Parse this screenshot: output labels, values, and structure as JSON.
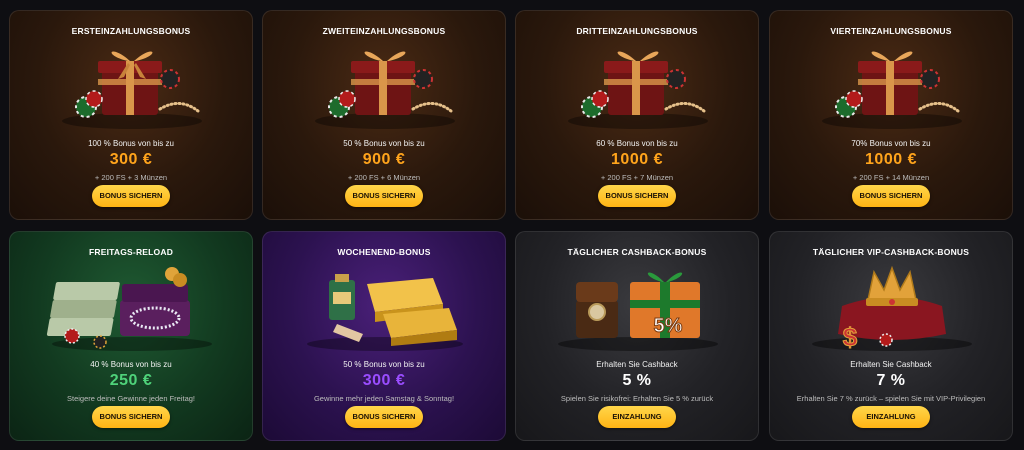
{
  "cards": [
    {
      "title": "ERSTEINZAHLUNGSBONUS",
      "desc": "100 % Bonus von bis zu",
      "amount": "300 €",
      "sub": "+ 200 FS + 3 Münzen",
      "button": "BONUS SICHERN",
      "art": "gift-box-icon"
    },
    {
      "title": "ZWEITEINZAHLUNGSBONUS",
      "desc": "50 % Bonus von bis zu",
      "amount": "900 €",
      "sub": "+ 200 FS + 6 Münzen",
      "button": "BONUS SICHERN",
      "art": "gift-box-icon"
    },
    {
      "title": "DRITTEINZAHLUNGSBONUS",
      "desc": "60 % Bonus von bis zu",
      "amount": "1000 €",
      "sub": "+ 200 FS + 7 Münzen",
      "button": "BONUS SICHERN",
      "art": "gift-box-icon"
    },
    {
      "title": "VIERTEINZAHLUNGSBONUS",
      "desc": "70% Bonus von bis zu",
      "amount": "1000 €",
      "sub": "+ 200 FS + 14 Münzen",
      "button": "BONUS SICHERN",
      "art": "gift-box-icon"
    },
    {
      "title": "FREITAGS-RELOAD",
      "desc": "40 % Bonus von bis zu",
      "amount": "250 €",
      "sub": "Steigere deine Gewinne jeden Freitag!",
      "button": "BONUS SICHERN",
      "art": "money-jewelry-icon"
    },
    {
      "title": "WOCHENEND-BONUS",
      "desc": "50 % Bonus von bis zu",
      "amount": "300 €",
      "sub": "Gewinne mehr jeden Samstag & Sonntag!",
      "button": "BONUS SICHERN",
      "art": "gold-bars-icon"
    },
    {
      "title": "TÄGLICHER CASHBACK-BONUS",
      "desc": "Erhalten Sie Cashback",
      "amount": "5 %",
      "sub": "Spielen Sie risikofrei: Erhalten Sie 5 % zurück",
      "button": "EINZAHLUNG",
      "art": "cashback-gift-icon",
      "badge": "5%"
    },
    {
      "title": "TÄGLICHER VIP-CASHBACK-BONUS",
      "desc": "Erhalten Sie Cashback",
      "amount": "7 %",
      "sub": "Erhalten Sie 7 % zurück – spielen Sie mit VIP-Privilegien",
      "button": "EINZAHLUNG",
      "art": "crown-pillow-icon",
      "badge": "$"
    }
  ]
}
